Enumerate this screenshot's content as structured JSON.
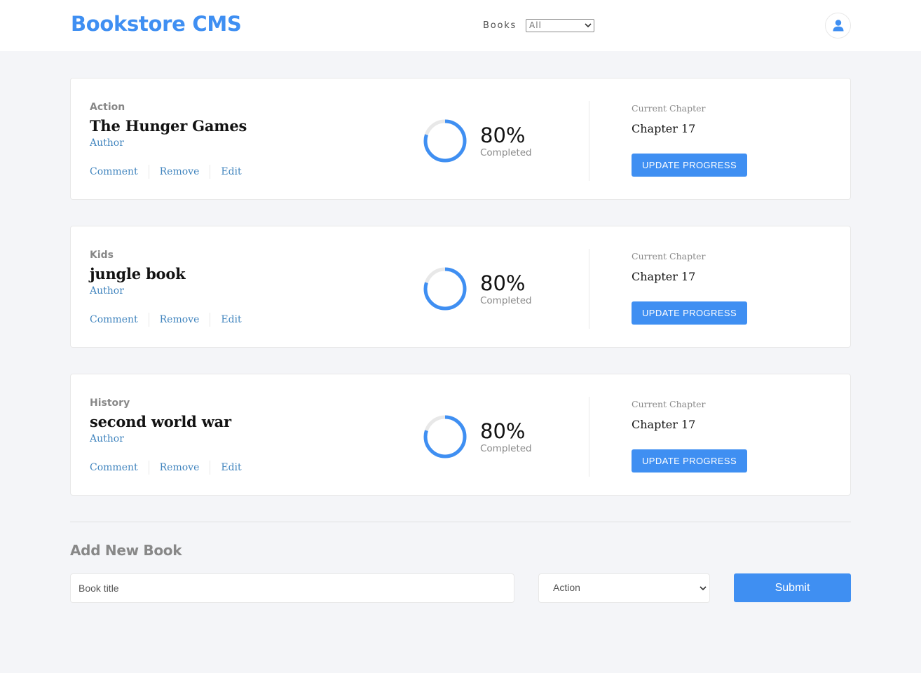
{
  "header": {
    "logo": "Bookstore CMS",
    "nav_label": "Books",
    "filter_selected": "All",
    "icons": {
      "avatar": "user-icon",
      "dropdown": "chevron-down-icon"
    }
  },
  "books": [
    {
      "genre": "Action",
      "title": "The Hunger Games",
      "author": "Author",
      "actions": {
        "comment": "Comment",
        "remove": "Remove",
        "edit": "Edit"
      },
      "progress": 80,
      "percent_label": "80%",
      "completed_label": "Completed",
      "current_chapter_label": "Current Chapter",
      "current_chapter": "Chapter 17",
      "update_label": "UPDATE PROGRESS"
    },
    {
      "genre": "Kids",
      "title": "jungle book",
      "author": "Author",
      "actions": {
        "comment": "Comment",
        "remove": "Remove",
        "edit": "Edit"
      },
      "progress": 80,
      "percent_label": "80%",
      "completed_label": "Completed",
      "current_chapter_label": "Current Chapter",
      "current_chapter": "Chapter 17",
      "update_label": "UPDATE PROGRESS"
    },
    {
      "genre": "History",
      "title": "second world war",
      "author": "Author",
      "actions": {
        "comment": "Comment",
        "remove": "Remove",
        "edit": "Edit"
      },
      "progress": 80,
      "percent_label": "80%",
      "completed_label": "Completed",
      "current_chapter_label": "Current Chapter",
      "current_chapter": "Chapter 17",
      "update_label": "UPDATE PROGRESS"
    }
  ],
  "form": {
    "title": "Add New Book",
    "title_placeholder": "Book title",
    "category_selected": "Action",
    "submit_label": "Submit"
  },
  "colors": {
    "accent": "#3f8ff2",
    "link": "#4386bf",
    "background": "#f4f5f8"
  }
}
